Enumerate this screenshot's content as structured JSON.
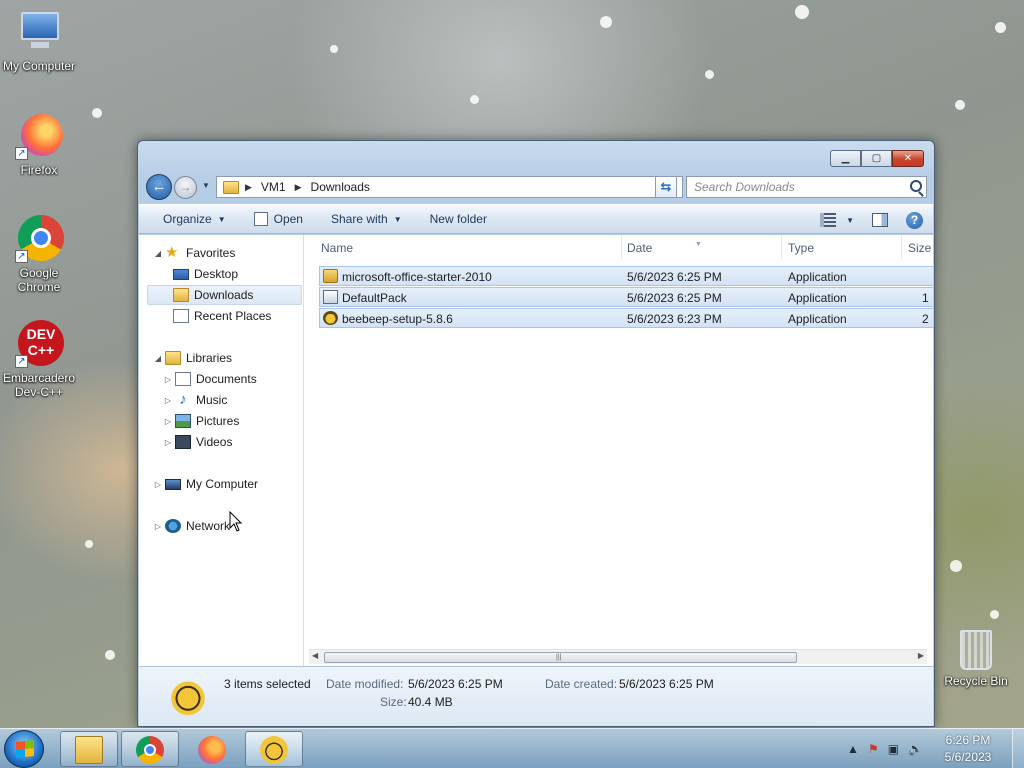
{
  "desktop": {
    "icons": [
      {
        "label": "My Computer"
      },
      {
        "label": "Firefox"
      },
      {
        "label": "Google Chrome"
      },
      {
        "label": "Embarcadero Dev-C++",
        "logo": "DEV C++"
      }
    ],
    "recycle_bin": "Recycle Bin"
  },
  "window": {
    "address": {
      "root": "VM1",
      "folder": "Downloads"
    },
    "search_placeholder": "Search Downloads",
    "toolbar": {
      "organize": "Organize",
      "open": "Open",
      "share_with": "Share with",
      "new_folder": "New folder"
    },
    "nav": {
      "favorites": "Favorites",
      "desktop": "Desktop",
      "downloads": "Downloads",
      "recent_places": "Recent Places",
      "libraries": "Libraries",
      "documents": "Documents",
      "music": "Music",
      "pictures": "Pictures",
      "videos": "Videos",
      "my_computer": "My Computer",
      "network": "Network"
    },
    "columns": {
      "name": "Name",
      "date": "Date",
      "type": "Type",
      "size": "Size"
    },
    "files": [
      {
        "name": "microsoft-office-starter-2010",
        "date": "5/6/2023 6:25 PM",
        "type": "Application",
        "size": "",
        "icon": "setup-icon"
      },
      {
        "name": "DefaultPack",
        "date": "5/6/2023 6:25 PM",
        "type": "Application",
        "size": "1",
        "icon": "package-icon"
      },
      {
        "name": "beebeep-setup-5.8.6",
        "date": "5/6/2023 6:23 PM",
        "type": "Application",
        "size": "2",
        "icon": "bee-icon"
      }
    ],
    "details": {
      "selection": "3 items selected",
      "date_modified_label": "Date modified:",
      "date_modified": "5/6/2023 6:25 PM",
      "date_created_label": "Date created:",
      "date_created": "5/6/2023 6:25 PM",
      "size_label": "Size:",
      "size": "40.4 MB"
    }
  },
  "taskbar": {
    "buttons": [
      "explorer-icon",
      "chrome-icon",
      "firefox-icon",
      "beebeep-icon"
    ],
    "time": "6:26 PM",
    "date": "5/6/2023"
  },
  "colors": {
    "selection_bg": "#d2e2f5",
    "selection_border": "#a9c4e6",
    "close_button": "#c8452b"
  }
}
